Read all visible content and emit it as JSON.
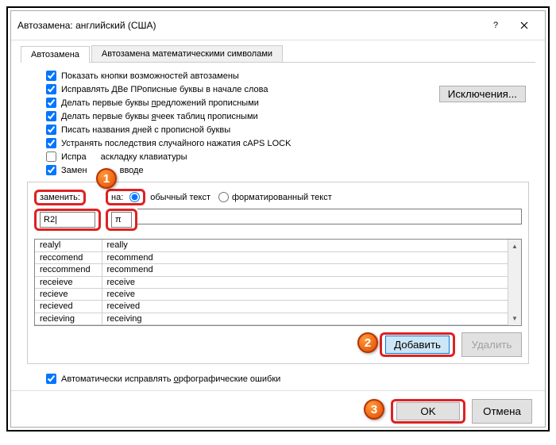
{
  "title": "Автозамена: английский (США)",
  "tabs": {
    "autocorrect": "Автозамена",
    "math": "Автозамена математическими символами"
  },
  "checks": {
    "showButtons": "Показать кнопки возможностей автозамены",
    "twoCaps": "Исправлять ДВе ПРописные буквы в начале слова",
    "capSentence": "Делать первые буквы предложений прописными",
    "capCells": "Делать первые буквы ячеек таблиц прописными",
    "capDays": "Писать названия дней с прописной буквы",
    "capsLock": "Устранять последствия случайного нажатия cAPS LOCK",
    "keyboard": "Исправлять раскладку клавиатуры",
    "onType": "Заменять при вводе"
  },
  "exceptionsBtn": "Исключения...",
  "labels": {
    "replace": "заменить:",
    "with": "на:"
  },
  "radios": {
    "plain": "обычный текст",
    "formatted": "форматированный текст"
  },
  "input": {
    "replace": "R2|",
    "with": "π"
  },
  "table": [
    {
      "from": "realyl",
      "to": "really"
    },
    {
      "from": "reccomend",
      "to": "recommend"
    },
    {
      "from": "reccommend",
      "to": "recommend"
    },
    {
      "from": "receieve",
      "to": "receive"
    },
    {
      "from": "recieve",
      "to": "receive"
    },
    {
      "from": "recieved",
      "to": "received"
    },
    {
      "from": "recieving",
      "to": "receiving"
    }
  ],
  "buttons": {
    "add": "Добавить",
    "delete": "Удалить",
    "ok": "OK",
    "cancel": "Отмена"
  },
  "autoSpell": "Автоматически исправлять орфографические ошибки",
  "badges": {
    "one": "1",
    "two": "2",
    "three": "3"
  }
}
